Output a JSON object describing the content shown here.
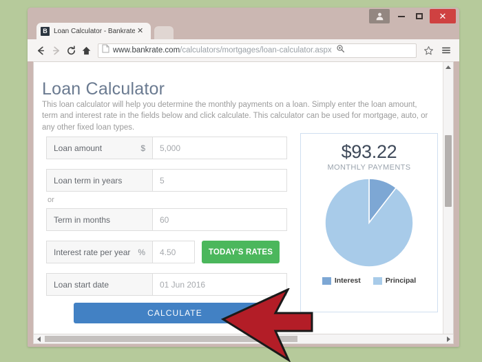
{
  "window": {
    "controls": {
      "user_icon": "user-avatar-icon",
      "minimize_label": "–",
      "maximize_label": "□",
      "close_label": "✕"
    }
  },
  "browser": {
    "tab": {
      "favicon_letter": "B",
      "title": "Loan Calculator - Bankrate",
      "close_label": "✕"
    },
    "toolbar": {
      "back_icon": "back-arrow-icon",
      "forward_icon": "forward-arrow-icon",
      "reload_icon": "reload-icon",
      "home_icon": "home-icon",
      "page_icon": "page-document-icon",
      "zoom_icon": "zoom-magnifier-icon",
      "bookmark_icon": "star-icon",
      "menu_icon": "hamburger-menu-icon",
      "url_host": "www.bankrate.com",
      "url_path": "/calculators/mortgages/loan-calculator.aspx",
      "url_full": "www.bankrate.com/calculators/mortgages/loan-calculator.aspx"
    }
  },
  "page": {
    "title": "Loan Calculator",
    "intro": "This loan calculator will help you determine the monthly payments on a loan. Simply enter the loan amount, term and interest rate in the fields below and click calculate. This calculator can be used for mortgage, auto, or any other fixed loan types.",
    "or_divider": "or",
    "fields": [
      {
        "label": "Loan amount",
        "unit": "$",
        "value": "5,000"
      },
      {
        "label": "Loan term in years",
        "unit": "",
        "value": "5"
      },
      {
        "label": "Term in months",
        "unit": "",
        "value": "60"
      },
      {
        "label": "Interest rate per year",
        "unit": "%",
        "value": "4.50"
      },
      {
        "label": "Loan start date",
        "unit": "",
        "value": "01 Jun 2016"
      }
    ],
    "rates_button": "TODAY'S RATES",
    "calculate_button": "CALCULATE",
    "results": {
      "amount": "$93.22",
      "caption": "MONTHLY PAYMENTS"
    }
  },
  "chart_data": {
    "type": "pie",
    "title": "",
    "categories": [
      "Interest",
      "Principal"
    ],
    "values": [
      10.5,
      89.5
    ],
    "colors": [
      "#7da7d4",
      "#a8cbe9"
    ],
    "legend": [
      "Interest",
      "Principal"
    ],
    "legend_position": "bottom",
    "start_angle_deg": 0,
    "units": "percent"
  },
  "annotation": {
    "arrow": {
      "icon": "left-pointing-arrow-annotation",
      "fill": "#b31d27",
      "stroke": "#1a1a1a"
    }
  },
  "colors": {
    "desktop_background": "#b6ca9b",
    "browser_chrome": "#cbb7b2",
    "accent_blue": "#4281c4",
    "accent_green": "#4bb75c",
    "close_red": "#cf4141",
    "heading_blue_gray": "#6a7a90"
  },
  "scrollbars": {
    "vertical_up": "▲",
    "vertical_down": "▼",
    "horizontal_left": "◀",
    "horizontal_right": "▶"
  }
}
